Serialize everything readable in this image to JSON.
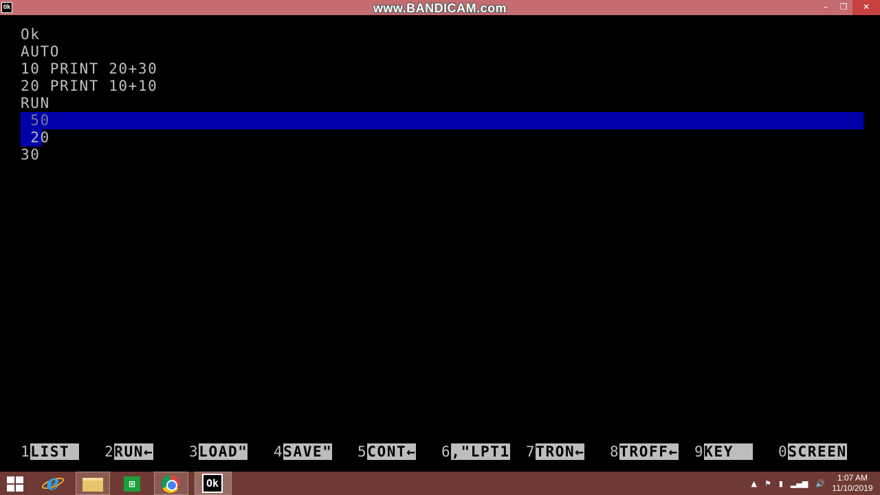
{
  "window": {
    "icon_text": "Ok",
    "watermark": "www.BANDICAM.com",
    "controls": {
      "minimize": "–",
      "restore": "❐",
      "close": "✕"
    }
  },
  "console": {
    "lines": [
      "Ok",
      "AUTO",
      "10 PRINT 20+30",
      "20 PRINT 10+10",
      "RUN",
      " 50",
      " 20",
      "30"
    ],
    "selection_color": "#0000aa"
  },
  "function_keys": [
    {
      "num": "1",
      "label": "LIST "
    },
    {
      "num": "2",
      "label": "RUN←"
    },
    {
      "num": "3",
      "label": "LOAD\""
    },
    {
      "num": "4",
      "label": "SAVE\""
    },
    {
      "num": "5",
      "label": "CONT←"
    },
    {
      "num": "6",
      "label": ",\"LPT1"
    },
    {
      "num": "7",
      "label": "TRON←"
    },
    {
      "num": "8",
      "label": "TROFF←"
    },
    {
      "num": "9",
      "label": "KEY  "
    },
    {
      "num": "0",
      "label": "SCREEN"
    }
  ],
  "taskbar": {
    "start_icon": "windows-start-icon",
    "pinned": [
      "internet-explorer-icon",
      "file-explorer-icon",
      "store-icon",
      "chrome-icon",
      "gwbasic-icon"
    ],
    "basic_icon_text": "Ok",
    "store_icon_text": "⊞",
    "tray": {
      "up_arrow": "▲",
      "flag": "⚑",
      "battery": "▮",
      "network": "▂▄▆",
      "volume": "🔊"
    },
    "clock": {
      "time": "1:07 AM",
      "date": "11/10/2019"
    }
  }
}
